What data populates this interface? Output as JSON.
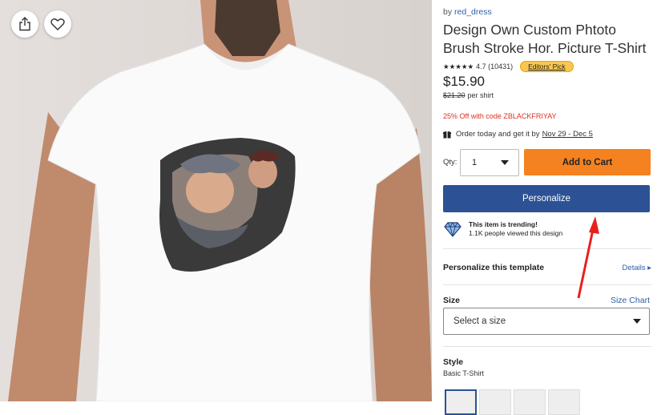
{
  "product": {
    "by_prefix": "by",
    "seller": "red_dress",
    "title": "Design Own Custom Phtoto Brush Stroke Hor. Picture T-Shirt",
    "stars": "★★★★★",
    "rating_text": "4.7 (10431)",
    "badge": "Editors' Pick",
    "price": "$15.90",
    "old_price": "$21.20",
    "per_shirt": "per shirt",
    "promo": "25% Off with code ZBLACKFRIYAY",
    "ship_prefix": "Order today and get it by",
    "ship_dates": "Nov 29 - Dec 5"
  },
  "purchase": {
    "qty_label": "Qty:",
    "qty_value": "1",
    "add_to_cart": "Add to Cart",
    "personalize": "Personalize"
  },
  "trending": {
    "headline": "This item is trending!",
    "sub": "1.1K people viewed this design"
  },
  "sections": {
    "personalize_template": "Personalize this template",
    "details_link": "Details ▸",
    "size_label": "Size",
    "size_chart": "Size Chart",
    "size_placeholder": "Select a size",
    "style_label": "Style",
    "style_value": "Basic T-Shirt"
  },
  "icons": {
    "share": "share-icon",
    "favorite": "heart-icon",
    "gift": "gift-icon",
    "diamond": "diamond-icon",
    "caret": "caret-down-icon"
  },
  "colors": {
    "cart": "#f58220",
    "personalize": "#2c5295",
    "promo": "#e0301e",
    "annotation_arrow": "#e8201c"
  }
}
